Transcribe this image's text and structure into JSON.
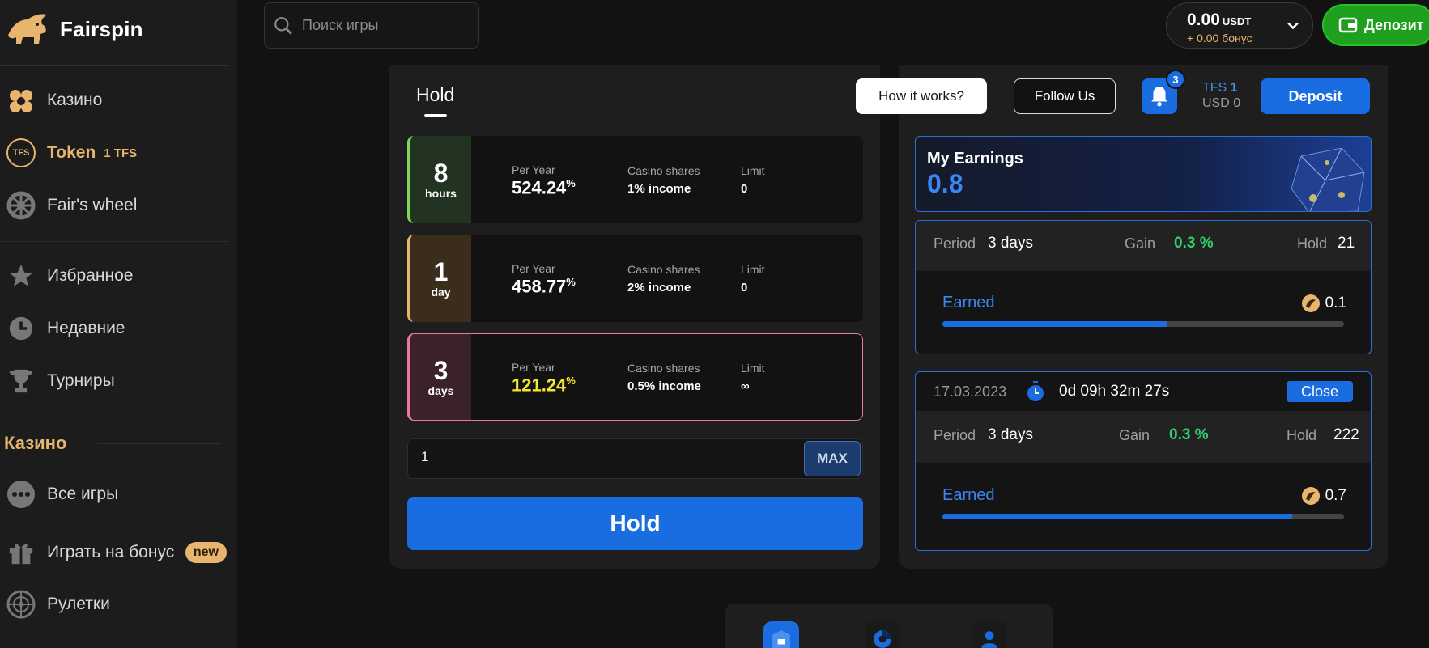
{
  "brand": {
    "name": "Fairspin"
  },
  "search": {
    "placeholder": "Поиск игры"
  },
  "sidebar": {
    "items": [
      {
        "label": "Казино",
        "icon": "clubs-icon"
      },
      {
        "label": "Token",
        "count": "1 TFS",
        "icon": "tfs-icon",
        "badge_text": "TFS"
      },
      {
        "label": "Fair's wheel",
        "icon": "wheel-icon"
      },
      {
        "label": "Избранное",
        "icon": "star-icon"
      },
      {
        "label": "Недавние",
        "icon": "clock-icon"
      },
      {
        "label": "Турниры",
        "icon": "trophy-icon"
      }
    ],
    "section_title": "Казино",
    "section_items": [
      {
        "label": "Все игры",
        "icon": "dots-icon"
      },
      {
        "label": "Играть на бонус",
        "icon": "gift-icon",
        "badge": "new"
      },
      {
        "label": "Рулетки",
        "icon": "roulette-icon"
      }
    ]
  },
  "balance": {
    "amount": "0.00",
    "currency": "USDT",
    "bonus": "+ 0.00 бонус"
  },
  "deposit_top": {
    "label": "Депозит"
  },
  "hold_tab": {
    "label": "Hold"
  },
  "plans": [
    {
      "num": "8",
      "unit": "hours",
      "per_year_label": "Per Year",
      "per_year": "524.24",
      "pct": "%",
      "shares_label": "Casino shares",
      "shares": "1% income",
      "limit_label": "Limit",
      "limit": "0",
      "accent": "#7ed957"
    },
    {
      "num": "1",
      "unit": "day",
      "per_year_label": "Per Year",
      "per_year": "458.77",
      "pct": "%",
      "shares_label": "Casino shares",
      "shares": "2% income",
      "limit_label": "Limit",
      "limit": "0",
      "accent": "#e8b56e"
    },
    {
      "num": "3",
      "unit": "days",
      "per_year_label": "Per Year",
      "per_year": "121.24",
      "pct": "%",
      "shares_label": "Casino shares",
      "shares": "0.5% income",
      "limit_label": "Limit",
      "limit": "∞",
      "accent": "#e87a9a"
    }
  ],
  "amount": {
    "value": "1",
    "max_label": "MAX"
  },
  "hold_button": {
    "label": "Hold"
  },
  "header_right": {
    "how_label": "How it works?",
    "follow_label": "Follow Us",
    "notif_count": "3",
    "tfs_label": "TFS",
    "tfs_value": "1",
    "usd_label": "USD",
    "usd_value": "0",
    "deposit_label": "Deposit"
  },
  "earnings": {
    "title": "My Earnings",
    "value": "0.8"
  },
  "holds": [
    {
      "period_label": "Period",
      "period": "3 days",
      "gain_label": "Gain",
      "gain": "0.3 %",
      "hold_label": "Hold",
      "hold": "21",
      "earned_label": "Earned",
      "earned": "0.1",
      "progress": 0.56
    },
    {
      "date": "17.03.2023",
      "timer": "0d 09h 32m 27s",
      "close_label": "Close",
      "period_label": "Period",
      "period": "3 days",
      "gain_label": "Gain",
      "gain": "0.3 %",
      "hold_label": "Hold",
      "hold": "222",
      "earned_label": "Earned",
      "earned": "0.7",
      "progress": 0.87
    }
  ],
  "colors": {
    "accent_blue": "#1a6de0",
    "gold": "#e8b56e",
    "green": "#1ea01e",
    "gain_green": "#2ed16a"
  }
}
